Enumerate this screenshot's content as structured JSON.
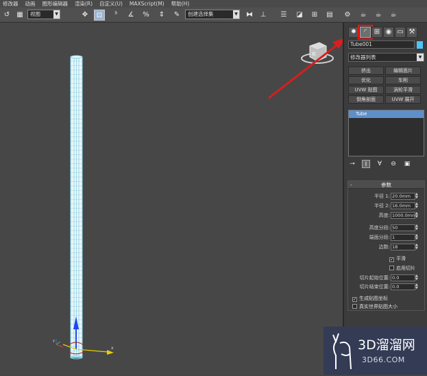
{
  "menubar": {
    "items": [
      "修改器",
      "动画",
      "图形编辑器",
      "渲染(R)",
      "自定义(U)",
      "MAXScript(M)",
      "帮助(H)"
    ]
  },
  "toolbar": {
    "view_select": "视图",
    "selection_set": "创建选择集",
    "icons": [
      "undo-icon",
      "select-filter-icon",
      "move-icon",
      "select-region-icon",
      "snap-3-icon",
      "angle-snap-icon",
      "percent-snap-icon",
      "spinner-snap-icon",
      "edit-named-sel-icon",
      "mirror-icon",
      "align-icon",
      "layer-icon",
      "curve-editor-icon",
      "schematic-icon",
      "material-editor-icon",
      "render-setup-icon",
      "render-frame-icon",
      "render-icon"
    ]
  },
  "viewport": {
    "object_label": "Tube001",
    "arrow_color": "#d81e1e",
    "highlight_color": "#e01818"
  },
  "command_panel": {
    "tabs": [
      "create-icon",
      "modify-icon",
      "hierarchy-icon",
      "motion-icon",
      "display-icon",
      "utilities-icon"
    ],
    "object_name": "Tube001",
    "object_color": "#4fc3f7",
    "modifier_list": "修改器列表",
    "modifier_buttons": [
      "挤出",
      "编辑面片",
      "优化",
      "车削",
      "UVW 贴图",
      "涡轮平滑",
      "倒角剖面",
      "UVW 展开"
    ],
    "stack": [
      "Tube"
    ],
    "parameters": {
      "title": "参数",
      "fields": [
        {
          "label": "半径 1:",
          "value": "20.0mm"
        },
        {
          "label": "半径 2:",
          "value": "16.0mm"
        },
        {
          "label": "高度:",
          "value": "1000.0mn"
        },
        {
          "label": "高度分段:",
          "value": "50"
        },
        {
          "label": "端面分段:",
          "value": "1"
        },
        {
          "label": "边数:",
          "value": "18"
        }
      ],
      "smooth": "平滑",
      "slice_on": "启用切片",
      "slice_from_label": "切片起始位置:",
      "slice_from_value": "0.0",
      "slice_to_label": "切片结束位置:",
      "slice_to_value": "0.0",
      "gen_mapping": "生成贴图坐标",
      "real_world": "真实世界贴图大小"
    }
  },
  "watermark": {
    "brand": "3D溜溜网",
    "url": "3D66.COM"
  }
}
